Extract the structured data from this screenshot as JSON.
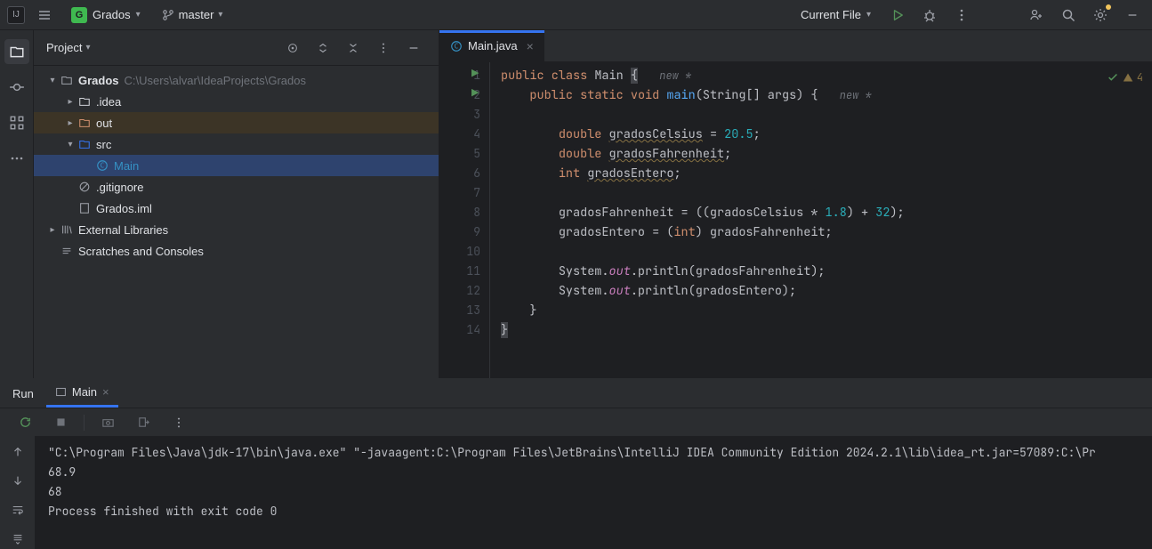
{
  "toolbar": {
    "project_initial": "G",
    "project_name": "Grados",
    "branch": "master",
    "run_config": "Current File"
  },
  "project_panel": {
    "title": "Project",
    "root_name": "Grados",
    "root_path": "C:\\Users\\alvar\\IdeaProjects\\Grados",
    "idea_folder": ".idea",
    "out_folder": "out",
    "src_folder": "src",
    "main_file": "Main",
    "gitignore": ".gitignore",
    "iml": "Grados.iml",
    "ext_lib": "External Libraries",
    "scratches": "Scratches and Consoles"
  },
  "editor": {
    "tab_name": "Main.java",
    "inspection_count": "4",
    "hint_new": "new *",
    "lines": {
      "l1a": "public",
      "l1b": "class",
      "l1c": "Main",
      "l1d": "{",
      "l2a": "public",
      "l2b": "static",
      "l2c": "void",
      "l2d": "main",
      "l2e": "(String[] args) {",
      "l4a": "double",
      "l4b": "gradosCelsius",
      "l4c": " = ",
      "l4d": "20.5",
      "l4e": ";",
      "l5a": "double",
      "l5b": "gradosFahrenheit",
      "l5c": ";",
      "l6a": "int",
      "l6b": "gradosEntero",
      "l6c": ";",
      "l8a": "gradosFahrenheit = ((gradosCelsius * ",
      "l8b": "1.8",
      "l8c": ") + ",
      "l8d": "32",
      "l8e": ");",
      "l9a": "gradosEntero = (",
      "l9b": "int",
      "l9c": ") gradosFahrenheit;",
      "l11a": "System.",
      "l11b": "out",
      "l11c": ".println(gradosFahrenheit);",
      "l12a": "System.",
      "l12b": "out",
      "l12c": ".println(gradosEntero);",
      "l13": "}",
      "l14": "}"
    },
    "gutter": [
      "1",
      "2",
      "3",
      "4",
      "5",
      "6",
      "7",
      "8",
      "9",
      "10",
      "11",
      "12",
      "13",
      "14"
    ]
  },
  "run": {
    "title": "Run",
    "tab": "Main",
    "console_line1": "\"C:\\Program Files\\Java\\jdk-17\\bin\\java.exe\" \"-javaagent:C:\\Program Files\\JetBrains\\IntelliJ IDEA Community Edition 2024.2.1\\lib\\idea_rt.jar=57089:C:\\Pr",
    "console_line2": "68.9",
    "console_line3": "68",
    "console_line4": "",
    "console_line5": "Process finished with exit code 0"
  }
}
